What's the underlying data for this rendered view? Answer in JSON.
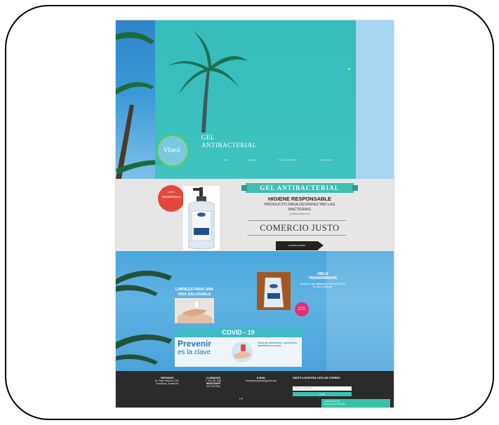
{
  "hero": {
    "title_line1": "GEL",
    "title_line2": "ANTIBACTERIAL",
    "logo_text": "Vloeii",
    "nav": [
      "Inicio",
      "Nosotros",
      "Nuestros Productos",
      "Contáctanos"
    ]
  },
  "product": {
    "badge_top": "100%",
    "badge_bottom": "GARANTIZADO",
    "ribbon": "GEL ANTIBACTERIAL",
    "heading": "HIGIENE RESPONSABLE",
    "sub1": "PRODUCTO PARA DESINFECTAR LAS",
    "sub2": "BACTERIAS",
    "small": "y tenlas mejor en ti",
    "fair_trade": "COMERCIO JUSTO",
    "buy_button": "COMPRA AHORA"
  },
  "section2": {
    "clean_title_1": "LIMPIEZA PARA UNA",
    "clean_title_2": "VIDA SALUDABLE",
    "ice_title_1": "HIELO",
    "ice_title_2": "TRANSPARENTE",
    "ice_text": "Alcohol en gel antibacterial. Elimina el 99.9% de virus y bacterias.",
    "pink_badge": "Nuevo y mejorado"
  },
  "covid": {
    "header": "COVID - 19",
    "prevent_1": "Prevenir",
    "prevent_2": "es la clave",
    "info": "Utiliza gel antibacterial o alcohol para desinfectar tus manos"
  },
  "footer": {
    "visit_title": "VISÍTANOS",
    "visit_text": "Av. Pablo Miranda 1234, Guadalupe, Zacatecas",
    "call_title": "LLÁMANOS",
    "call_text": "T. 493 109 1984",
    "whatsapp_title": "WHATSAPP",
    "whatsapp_text": "493 109 1984",
    "email_title": "E-MAIL",
    "email_text": "hologelazacatecas@gmail.com",
    "list_title": "ÚNETE A NUESTRA LISTA DE CORREO",
    "email_placeholder": "Ingresa tu email aquí*",
    "send": "Enviar",
    "social": "f  ♥",
    "chat_1": "¿Necesitas Ayuda?",
    "chat_2": "Escríbenos por WhatsApp"
  }
}
